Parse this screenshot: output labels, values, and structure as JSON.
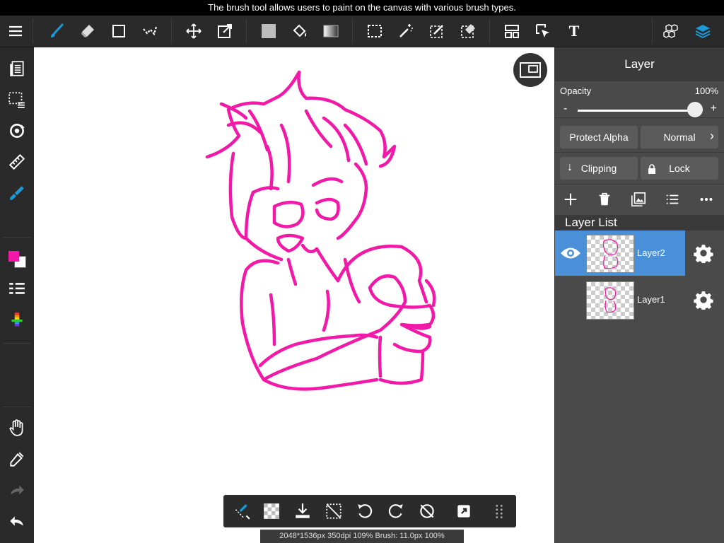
{
  "tooltip": "The brush tool allows users to paint on the canvas with various brush types.",
  "toolbar": {
    "items": [
      "menu-icon",
      "brush-icon",
      "eraser-icon",
      "rectangle-icon",
      "smudge-icon",
      "move-icon",
      "transform-icon",
      "fill-color-icon",
      "bucket-icon",
      "gradient-icon",
      "select-rect-icon",
      "magic-wand-icon",
      "select-pen-icon",
      "select-eraser-icon",
      "frame-divider-icon",
      "operation-icon",
      "text-icon",
      "3d-model-icon",
      "layers-icon"
    ],
    "text_tool_label": "T"
  },
  "leftbar": {
    "items": [
      "gallery-icon",
      "selection-icon",
      "rotate-icon",
      "ruler-icon",
      "brush-pen-icon",
      "color-icon",
      "list-icon",
      "palette-icon",
      "hand-icon",
      "eyedropper-icon",
      "redo-icon",
      "undo-icon"
    ],
    "primary_color": "#f218a8",
    "secondary_color": "#ffffff"
  },
  "status_bar": "2048*1536px 350dpi 109% Brush: 11.0px 100%",
  "layer_panel": {
    "title": "Layer",
    "opacity_label": "Opacity",
    "opacity_value": "100%",
    "minus": "-",
    "plus": "+",
    "protect_alpha": "Protect Alpha",
    "blend_mode": "Normal",
    "clipping": "Clipping",
    "lock": "Lock",
    "layer_list_title": "Layer List",
    "layers": [
      {
        "name": "Layer2",
        "selected": true,
        "visible": true
      },
      {
        "name": "Layer1",
        "selected": false,
        "visible": false
      }
    ]
  },
  "colors": {
    "accent": "#1a9bd7",
    "selection": "#4a90d9",
    "stroke": "#f218a8"
  }
}
